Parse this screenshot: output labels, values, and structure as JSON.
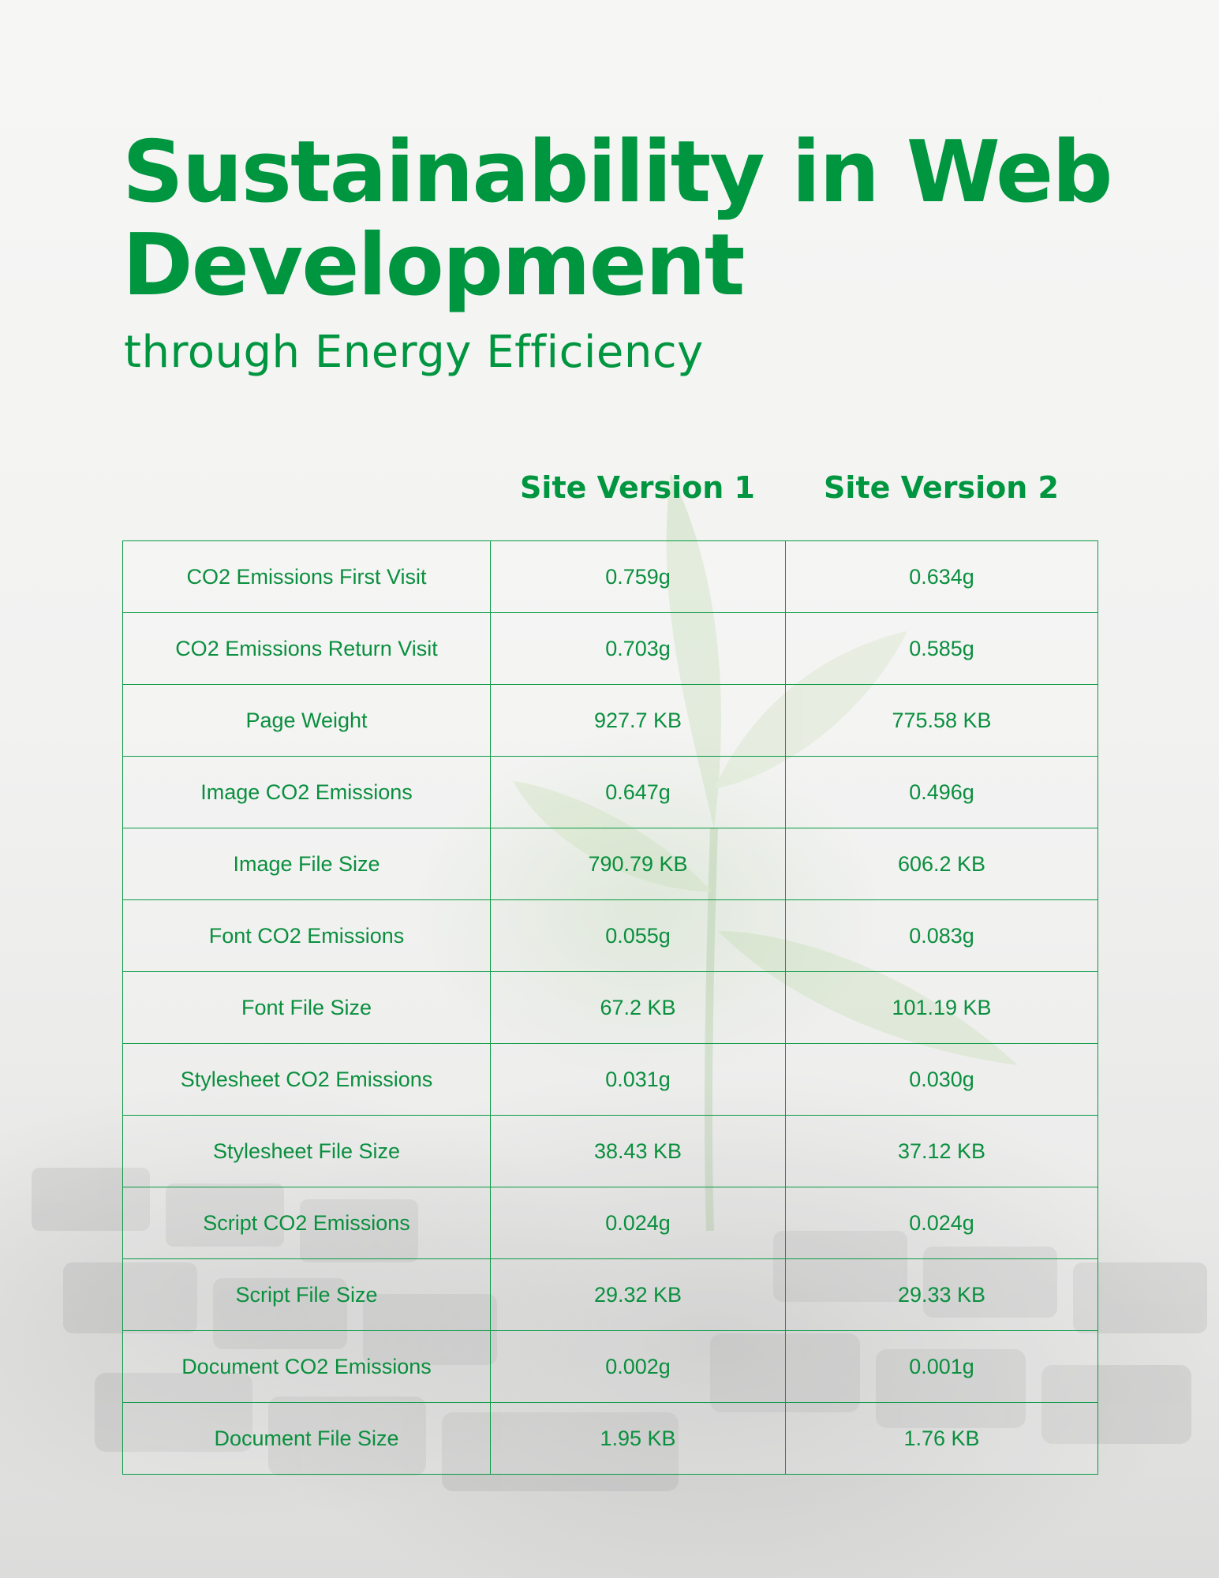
{
  "title": "Sustainability in Web Development",
  "subtitle": "through Energy Efficiency",
  "columns": [
    "Site Version 1",
    "Site Version 2"
  ],
  "rows": [
    {
      "label": "CO2 Emissions First Visit",
      "v1": "0.759g",
      "v2": "0.634g"
    },
    {
      "label": "CO2 Emissions Return Visit",
      "v1": "0.703g",
      "v2": "0.585g"
    },
    {
      "label": "Page Weight",
      "v1": "927.7 KB",
      "v2": "775.58 KB"
    },
    {
      "label": "Image CO2 Emissions",
      "v1": "0.647g",
      "v2": "0.496g"
    },
    {
      "label": "Image File Size",
      "v1": "790.79 KB",
      "v2": "606.2 KB"
    },
    {
      "label": "Font CO2 Emissions",
      "v1": "0.055g",
      "v2": "0.083g"
    },
    {
      "label": "Font File Size",
      "v1": "67.2 KB",
      "v2": "101.19 KB"
    },
    {
      "label": "Stylesheet CO2 Emissions",
      "v1": "0.031g",
      "v2": "0.030g"
    },
    {
      "label": "Stylesheet File Size",
      "v1": "38.43 KB",
      "v2": "37.12 KB"
    },
    {
      "label": "Script CO2 Emissions",
      "v1": "0.024g",
      "v2": "0.024g"
    },
    {
      "label": "Script File Size",
      "v1": "29.32 KB",
      "v2": "29.33 KB"
    },
    {
      "label": "Document CO2 Emissions",
      "v1": "0.002g",
      "v2": "0.001g"
    },
    {
      "label": "Document File Size",
      "v1": "1.95 KB",
      "v2": "1.76 KB"
    }
  ],
  "colors": {
    "accent": "#009640",
    "table_text": "#0a8f3e"
  }
}
